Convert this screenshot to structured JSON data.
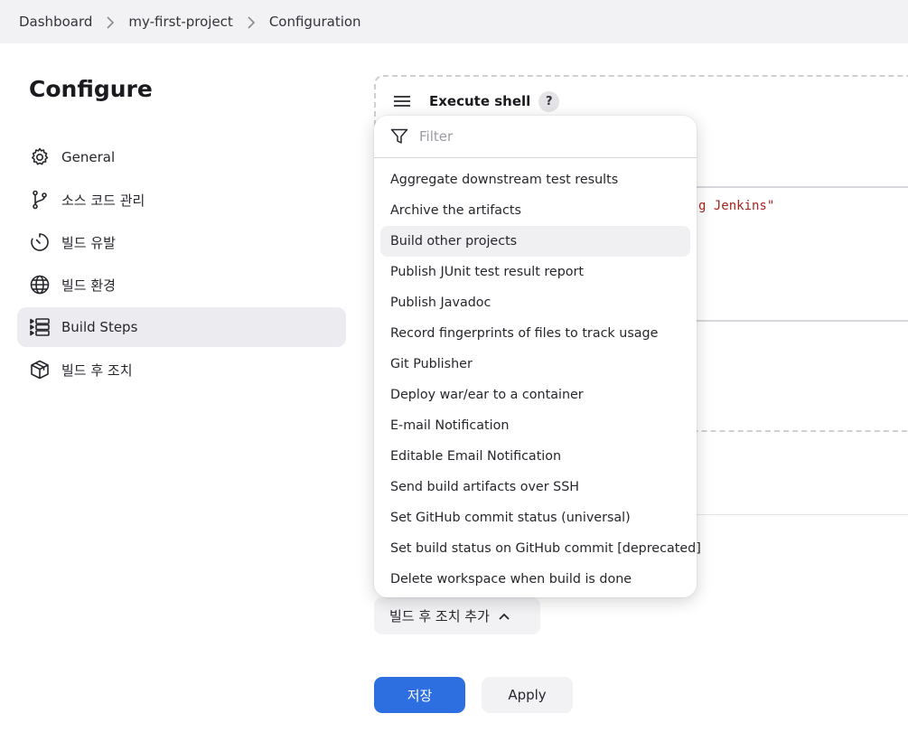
{
  "breadcrumb": [
    "Dashboard",
    "my-first-project",
    "Configuration"
  ],
  "page": {
    "title": "Configure"
  },
  "sidebar": {
    "items": [
      {
        "label": "General",
        "icon": "gear-icon"
      },
      {
        "label": "소스 코드 관리",
        "icon": "source-branch-icon"
      },
      {
        "label": "빌드 유발",
        "icon": "timer-icon"
      },
      {
        "label": "빌드 환경",
        "icon": "globe-icon"
      },
      {
        "label": "Build Steps",
        "icon": "list-icon",
        "active": true
      },
      {
        "label": "빌드 후 조치",
        "icon": "package-icon"
      }
    ]
  },
  "build_step": {
    "title": "Execute shell",
    "help": "?",
    "code_visible": "g Jenkins\""
  },
  "dropdown": {
    "filter_placeholder": "Filter",
    "items": [
      "Aggregate downstream test results",
      "Archive the artifacts",
      "Build other projects",
      "Publish JUnit test result report",
      "Publish Javadoc",
      "Record fingerprints of files to track usage",
      "Git Publisher",
      "Deploy war/ear to a container",
      "E-mail Notification",
      "Editable Email Notification",
      "Send build artifacts over SSH",
      "Set GitHub commit status (universal)",
      "Set build status on GitHub commit [deprecated]",
      "Delete workspace when build is done"
    ],
    "hovered_index": 2
  },
  "actions": {
    "add_post_build_label": "빌드 후 조치 추가",
    "save_label": "저장",
    "apply_label": "Apply"
  },
  "colors": {
    "primary": "#2d6fe0",
    "code_text": "#a3261f",
    "active_nav_bg": "#ececf0"
  }
}
